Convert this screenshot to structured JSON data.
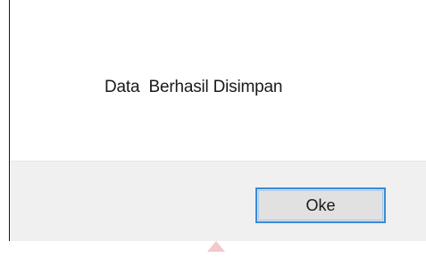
{
  "dialog": {
    "message": "Data  Berhasil Disimpan",
    "ok_label": "Oke"
  },
  "colors": {
    "button_border": "#3c8ad4",
    "button_bg": "#e1e1e1",
    "footer_bg": "#f0f0f0"
  }
}
